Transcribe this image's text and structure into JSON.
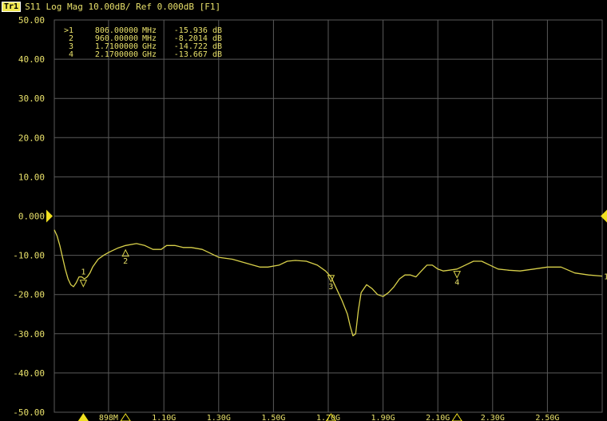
{
  "header": {
    "trace_badge": "Tr1",
    "trace_info": "S11 Log Mag 10.00dB/ Ref 0.000dB [F1]"
  },
  "colors": {
    "background": "#000000",
    "grid": "#5a5a5a",
    "trace": "#d8d04a",
    "text": "#e8e06a",
    "marker_arrow": "#f0e020"
  },
  "chart_data": {
    "type": "line",
    "xlabel": "",
    "ylabel": "",
    "x_unit": "GHz",
    "xlim": [
      0.7,
      2.7
    ],
    "ylim": [
      -50,
      50
    ],
    "grid": true,
    "y_tick_labels": [
      "50.00",
      "40.00",
      "30.00",
      "20.00",
      "10.00",
      "0.000",
      "-10.00",
      "-20.00",
      "-30.00",
      "-40.00",
      "-50.00"
    ],
    "y_tick_values": [
      50,
      40,
      30,
      20,
      10,
      0,
      -10,
      -20,
      -30,
      -40,
      -50
    ],
    "x_tick_labels": [
      "898M",
      "1.10G",
      "1.30G",
      "1.50G",
      "1.70G",
      "1.90G",
      "2.10G",
      "2.30G",
      "2.50G"
    ],
    "x_tick_values": [
      0.898,
      1.1,
      1.3,
      1.5,
      1.7,
      1.9,
      2.1,
      2.3,
      2.5
    ],
    "series": [
      {
        "x": [
          0.7,
          0.71,
          0.72,
          0.73,
          0.74,
          0.75,
          0.76,
          0.77,
          0.78,
          0.79,
          0.8,
          0.81,
          0.82,
          0.83,
          0.84,
          0.86,
          0.88,
          0.9,
          0.93,
          0.96,
          1.0,
          1.03,
          1.06,
          1.09,
          1.11,
          1.14,
          1.17,
          1.2,
          1.24,
          1.27,
          1.3,
          1.35,
          1.4,
          1.45,
          1.48,
          1.52,
          1.55,
          1.58,
          1.62,
          1.66,
          1.69,
          1.71,
          1.73,
          1.75,
          1.77,
          1.78,
          1.79,
          1.8,
          1.81,
          1.82,
          1.84,
          1.86,
          1.88,
          1.9,
          1.92,
          1.94,
          1.96,
          1.98,
          2.0,
          2.02,
          2.04,
          2.06,
          2.08,
          2.1,
          2.12,
          2.14,
          2.17,
          2.2,
          2.23,
          2.26,
          2.29,
          2.32,
          2.36,
          2.4,
          2.45,
          2.5,
          2.55,
          2.6,
          2.65,
          2.7
        ],
        "values": [
          -3.5,
          -5,
          -7.5,
          -10.5,
          -13.5,
          -16,
          -17.5,
          -18,
          -17,
          -15.5,
          -15.5,
          -16,
          -15.5,
          -14.5,
          -13,
          -11,
          -10,
          -9.2,
          -8.2,
          -7.5,
          -7,
          -7.5,
          -8.5,
          -8.5,
          -7.5,
          -7.5,
          -8,
          -8,
          -8.5,
          -9.5,
          -10.5,
          -11,
          -12,
          -13,
          -13,
          -12.5,
          -11.5,
          -11.3,
          -11.5,
          -12.5,
          -14,
          -15.5,
          -18.5,
          -21.5,
          -25,
          -28,
          -30.5,
          -30,
          -24,
          -19.5,
          -17.5,
          -18.5,
          -20,
          -20.5,
          -19.5,
          -18,
          -16,
          -15,
          -15,
          -15.5,
          -14,
          -12.5,
          -12.5,
          -13.5,
          -14,
          -13.8,
          -13.5,
          -12.5,
          -11.5,
          -11.5,
          -12.5,
          -13.5,
          -13.8,
          -14,
          -13.5,
          -13,
          -13,
          -14.5,
          -15,
          -15.3
        ]
      }
    ],
    "markers": [
      {
        "label": "1",
        "freq_text": "806.00000 MHz",
        "value_text": "-15.936 dB",
        "x": 0.806,
        "y": -15.936,
        "active": true
      },
      {
        "label": "2",
        "freq_text": "960.00000 MHz",
        "value_text": "-8.2014 dB",
        "x": 0.96,
        "y": -8.2014,
        "active": false
      },
      {
        "label": "3",
        "freq_text": "1.7100000 GHz",
        "value_text": "-14.722 dB",
        "x": 1.71,
        "y": -14.722,
        "active": false
      },
      {
        "label": "4",
        "freq_text": "2.1700000 GHz",
        "value_text": "-13.667 dB",
        "x": 2.17,
        "y": -13.667,
        "active": false
      }
    ],
    "marker_table_rows": [
      {
        "prefix": ">1",
        "freq": "806.00000",
        "unit": "MHz",
        "value": "-15.936 dB"
      },
      {
        "prefix": "2",
        "freq": "960.00000",
        "unit": "MHz",
        "value": "-8.2014 dB"
      },
      {
        "prefix": "3",
        "freq": "1.7100000",
        "unit": "GHz",
        "value": "-14.722 dB"
      },
      {
        "prefix": "4",
        "freq": "2.1700000",
        "unit": "GHz",
        "value": "-13.667 dB"
      }
    ],
    "trace_end_label": "1"
  }
}
